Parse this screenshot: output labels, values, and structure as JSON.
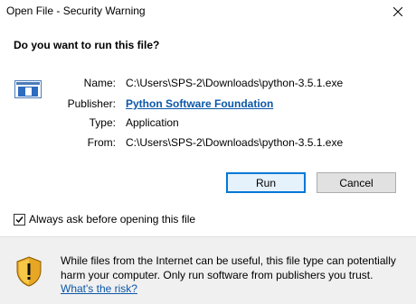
{
  "window": {
    "title": "Open File - Security Warning"
  },
  "heading": "Do you want to run this file?",
  "fields": {
    "name_label": "Name:",
    "name_value": "C:\\Users\\SPS-2\\Downloads\\python-3.5.1.exe",
    "publisher_label": "Publisher:",
    "publisher_value": "Python Software Foundation",
    "type_label": "Type:",
    "type_value": "Application",
    "from_label": "From:",
    "from_value": "C:\\Users\\SPS-2\\Downloads\\python-3.5.1.exe"
  },
  "buttons": {
    "run_label": "Run",
    "cancel_label": "Cancel"
  },
  "checkbox": {
    "label": "Always ask before opening this file",
    "checked": true
  },
  "warning": {
    "line1": "While files from the Internet can be useful, this file type can potentially",
    "line2": "harm your computer. Only run software from publishers you trust.",
    "link": "What's the risk?"
  },
  "icons": {
    "file": "application-file-icon",
    "warning": "security-shield-icon",
    "close": "close-icon"
  },
  "colors": {
    "link": "#0b57a8",
    "focus_border": "#0078d7",
    "panel_bg": "#f0f0f0"
  }
}
